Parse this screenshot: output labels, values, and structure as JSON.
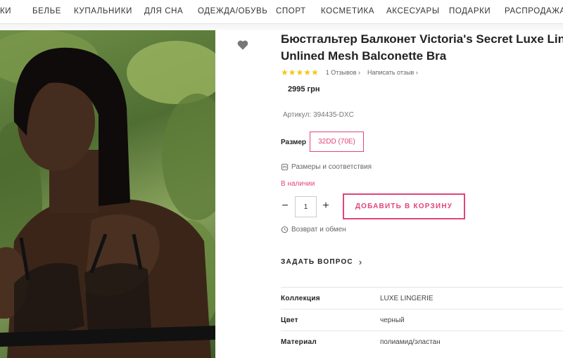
{
  "nav": {
    "items": [
      "КИ",
      "БЕЛЬЕ",
      "КУПАЛЬНИКИ",
      "ДЛЯ СНА",
      "ОДЕЖДА/ОБУВЬ",
      "СПОРТ",
      "КОСМЕТИКА",
      "АКСЕСУАРЫ",
      "ПОДАРКИ",
      "РАСПРОДАЖА"
    ]
  },
  "icons": {
    "wishlist": "heart-icon",
    "rating": "star-icon",
    "sizes": "size-chart-icon",
    "returns": "return-icon",
    "chevron": "chevron-right-icon"
  },
  "product": {
    "title_line1": "Бюстгальтер Балконет Victoria's Secret Luxe Lin",
    "title_line2": "Unlined Mesh Balconette Bra",
    "stars": "★★★★★",
    "rating_value": 5,
    "reviews_link": "1 Отзывов ›",
    "write_review": "Написать отзыв ›",
    "price": "2995 грн",
    "sku_label": "Артикул:",
    "sku_value": "394435-DXC",
    "size_label": "Размер",
    "size_selected": "32DD (70E)",
    "sizes_link": "Размеры и соответствия",
    "stock": "В наличии",
    "qty_minus": "−",
    "qty_value": "1",
    "qty_plus": "+",
    "add_to_cart": "ДОБАВИТЬ В КОРЗИНУ",
    "returns_link": "Возврат и обмен",
    "ask": "ЗАДАТЬ ВОПРОС",
    "ask_chevron": "›"
  },
  "specs": [
    {
      "key": "Коллекция",
      "value": "LUXE LINGERIE"
    },
    {
      "key": "Цвет",
      "value": "черный"
    },
    {
      "key": "Материал",
      "value": "полиамид/эластан"
    }
  ],
  "colors": {
    "accent": "#e0457b",
    "star": "#f5c518"
  }
}
